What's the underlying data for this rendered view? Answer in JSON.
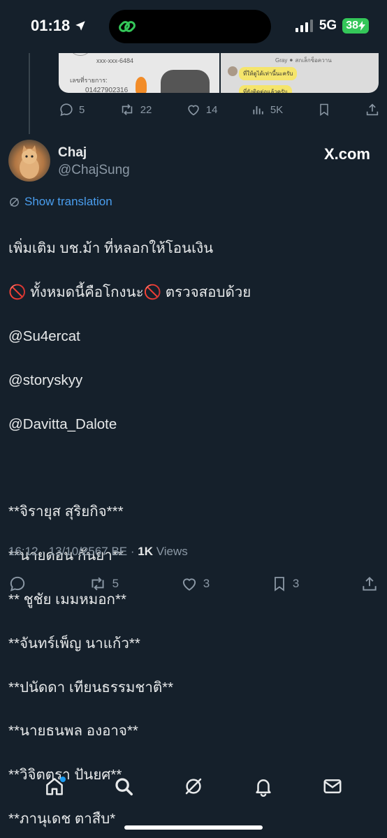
{
  "status_bar": {
    "time": "01:18",
    "network": "5G",
    "battery": "38"
  },
  "previous_tweet": {
    "media_left_lines": [
      "xxx-xxx-6484",
      "เลขที่รายการ:",
      "01427902316"
    ],
    "media_right_lines": [
      "Gray ⚫ สกเล็กซ็อควาน",
      "ที่ให้ดูได้เท่านี้นะครับ",
      "ที่ยังติดต่อแล้วครับ"
    ],
    "actions": {
      "replies": "5",
      "retweets": "22",
      "likes": "14",
      "views": "5K"
    }
  },
  "tweet": {
    "author_name": "Chaj",
    "author_handle": "@ChajSung",
    "watermark": "X.com",
    "show_translation": "Show translation",
    "lines": [
      "เพิ่มเติม บช.ม้า ที่หลอกให้โอนเงิน",
      "🚫 ทั้งหมดนี้คือโกงนะ🚫 ตรวจสอบด้วย",
      "@Su4ercat",
      "@storyskyy",
      "@Davitta_Dalote",
      "",
      "**จิรายุส สุริยกิจ***",
      "**นายดอน กันยา**",
      "** ชูชัย เมมหมอก**",
      "**จันทร์เพ็ญ นาแก้ว**",
      "**ปนัดดา เทียนธรรมชาติ**",
      "**นายธนพล องอาจ**",
      "**วิจิตตรา ปันยศ**",
      "**ภานุเดช ตาสืบ*"
    ],
    "timestamp": "16:12 · 13/10/2567 BE · ",
    "views_count": "1K",
    "views_label": " Views",
    "actions": {
      "retweets": "5",
      "likes": "3",
      "bookmarks": "3"
    }
  },
  "tab_bar": {
    "items": [
      "home-icon",
      "search-icon",
      "grok-icon",
      "notifications-icon",
      "messages-icon"
    ]
  },
  "colors": {
    "background": "#15202b",
    "accent": "#1d9bf0",
    "link": "#4a9eef",
    "muted": "#8b98a5"
  }
}
